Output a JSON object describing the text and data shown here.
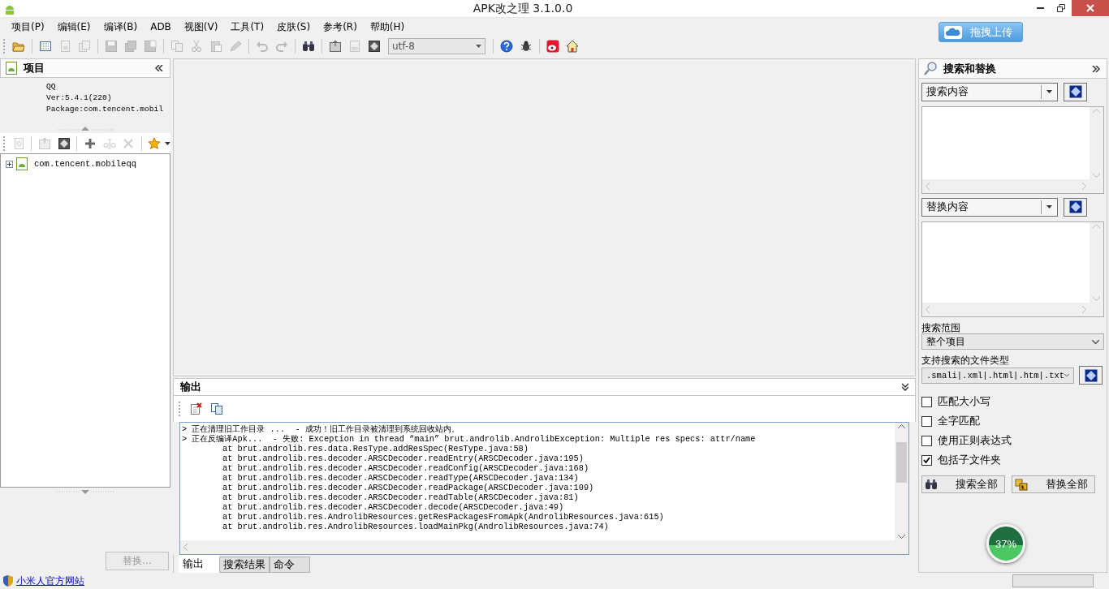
{
  "window": {
    "title": "APK改之理 3.1.0.0"
  },
  "menu": [
    "项目(P)",
    "编辑(E)",
    "编译(B)",
    "ADB",
    "视图(V)",
    "工具(T)",
    "皮肤(S)",
    "参考(R)",
    "帮助(H)"
  ],
  "toolbar": [
    {
      "kind": "button",
      "disabled": false
    },
    {
      "kind": "separator"
    },
    {
      "kind": "button",
      "disabled": false
    },
    {
      "kind": "button",
      "disabled": true
    },
    {
      "kind": "button",
      "disabled": true
    },
    {
      "kind": "separator"
    },
    {
      "kind": "button",
      "disabled": true
    },
    {
      "kind": "button",
      "disabled": true
    },
    {
      "kind": "button",
      "disabled": true
    },
    {
      "kind": "separator"
    },
    {
      "kind": "button",
      "disabled": true
    },
    {
      "kind": "button",
      "disabled": true
    },
    {
      "kind": "button",
      "disabled": true
    },
    {
      "kind": "button",
      "disabled": true
    },
    {
      "kind": "separator"
    },
    {
      "kind": "button",
      "disabled": true
    },
    {
      "kind": "button",
      "disabled": true
    },
    {
      "kind": "separator"
    },
    {
      "kind": "button",
      "disabled": false
    },
    {
      "kind": "separator"
    },
    {
      "kind": "button",
      "disabled": false
    },
    {
      "kind": "button",
      "disabled": true
    },
    {
      "kind": "button",
      "disabled": false
    },
    {
      "kind": "combo",
      "value": "utf-8"
    },
    {
      "kind": "separator"
    },
    {
      "kind": "button",
      "disabled": false
    },
    {
      "kind": "button",
      "disabled": false
    },
    {
      "kind": "separator"
    },
    {
      "kind": "button",
      "disabled": false
    },
    {
      "kind": "button",
      "disabled": false
    }
  ],
  "upload_button": "拖拽上传",
  "project_panel": {
    "title": "项目",
    "info": [
      "QQ",
      "Ver:5.4.1(220)",
      "Package:com.tencent.mobil"
    ],
    "toolbar": [
      {
        "kind": "button",
        "disabled": true
      },
      {
        "kind": "separator"
      },
      {
        "kind": "button",
        "disabled": true
      },
      {
        "kind": "button",
        "disabled": false
      },
      {
        "kind": "separator"
      },
      {
        "kind": "button",
        "disabled": false
      },
      {
        "kind": "button",
        "disabled": true
      },
      {
        "kind": "button",
        "disabled": true
      },
      {
        "kind": "separator"
      },
      {
        "kind": "button",
        "disabled": false
      }
    ],
    "tree": [
      {
        "label": "com.tencent.mobileqq",
        "expanded": false
      }
    ],
    "replace_button": {
      "label": "替换...",
      "disabled": true
    }
  },
  "output_panel": {
    "title": "输出",
    "lines": [
      {
        "kind": "message",
        "text": "> 正在清理旧工作目录 ...  - 成功！旧工作目录被清理到系统回收站内。"
      },
      {
        "kind": "message",
        "text": "> 正在反编译Apk...  - 失败: Exception in thread “main” brut.androlib.AndrolibException: Multiple res specs: attr/name"
      },
      {
        "kind": "trace",
        "text": "at brut.androlib.res.data.ResType.addResSpec(ResType.java:58)"
      },
      {
        "kind": "trace",
        "text": "at brut.androlib.res.decoder.ARSCDecoder.readEntry(ARSCDecoder.java:195)"
      },
      {
        "kind": "trace",
        "text": "at brut.androlib.res.decoder.ARSCDecoder.readConfig(ARSCDecoder.java:168)"
      },
      {
        "kind": "trace",
        "text": "at brut.androlib.res.decoder.ARSCDecoder.readType(ARSCDecoder.java:134)"
      },
      {
        "kind": "trace",
        "text": "at brut.androlib.res.decoder.ARSCDecoder.readPackage(ARSCDecoder.java:109)"
      },
      {
        "kind": "trace",
        "text": "at brut.androlib.res.decoder.ARSCDecoder.readTable(ARSCDecoder.java:81)"
      },
      {
        "kind": "trace",
        "text": "at brut.androlib.res.decoder.ARSCDecoder.decode(ARSCDecoder.java:49)"
      },
      {
        "kind": "trace",
        "text": "at brut.androlib.res.AndrolibResources.getResPackagesFromApk(AndrolibResources.java:615)"
      },
      {
        "kind": "trace",
        "text": "at brut.androlib.res.AndrolibResources.loadMainPkg(AndrolibResources.java:74)"
      }
    ],
    "tabs": [
      {
        "label": "输出",
        "selected": true
      },
      {
        "label": "搜索结果",
        "selected": false
      },
      {
        "label": "命令",
        "selected": false
      }
    ]
  },
  "search_panel": {
    "title": "搜索和替换",
    "search_combo": "搜索内容",
    "replace_combo": "替换内容",
    "scope_label": "搜索范围",
    "scope": "整个项目",
    "types_label": "支持搜索的文件类型",
    "types": ".smali|.xml|.html|.htm|.txt",
    "options": [
      {
        "label": "匹配大小写",
        "checked": false
      },
      {
        "label": "全字匹配",
        "checked": false
      },
      {
        "label": "使用正则表达式",
        "checked": false
      },
      {
        "label": "包括子文件夹",
        "checked": true
      }
    ],
    "buttons": [
      {
        "kind": "search",
        "label": "搜索全部"
      },
      {
        "kind": "replace",
        "label": "替换全部"
      }
    ]
  },
  "status_bar": {
    "link": "小米人官方网站"
  },
  "floating_widget": {
    "label": "37%"
  }
}
